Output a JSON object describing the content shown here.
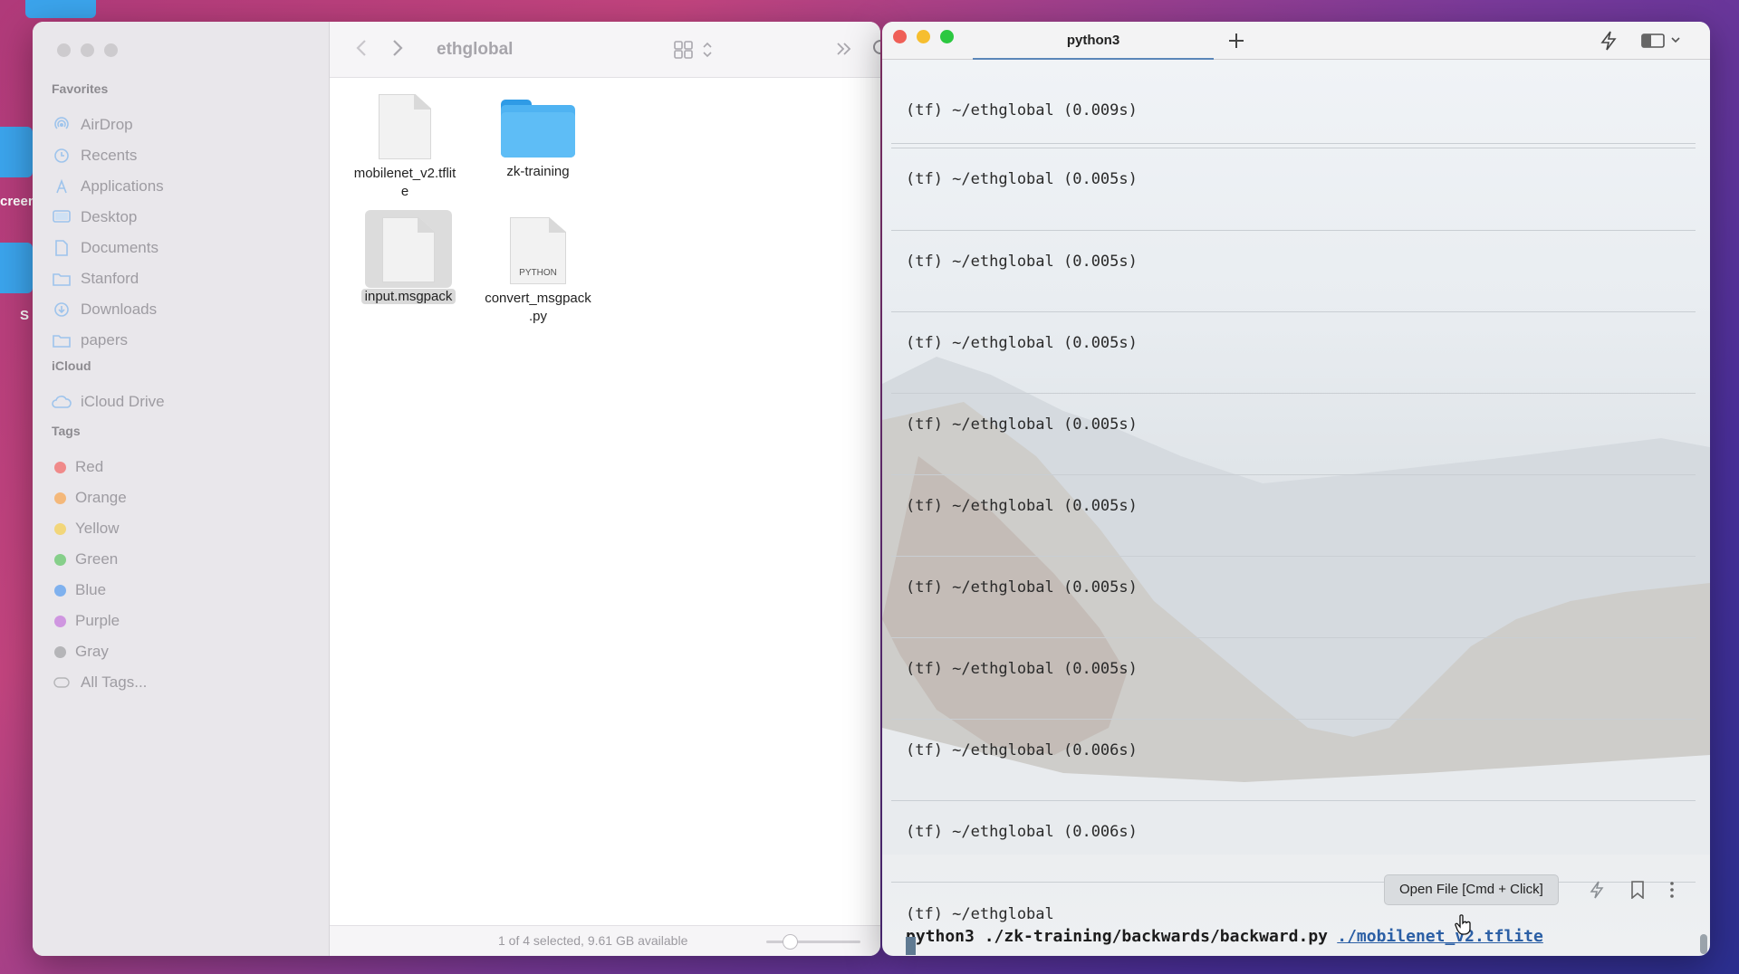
{
  "finder": {
    "title": "ethglobal",
    "sidebar": {
      "favorites_heading": "Favorites",
      "favorites": [
        {
          "label": "AirDrop",
          "icon": "airdrop-icon"
        },
        {
          "label": "Recents",
          "icon": "clock-icon"
        },
        {
          "label": "Applications",
          "icon": "applications-icon"
        },
        {
          "label": "Desktop",
          "icon": "desktop-icon"
        },
        {
          "label": "Documents",
          "icon": "document-icon"
        },
        {
          "label": "Stanford",
          "icon": "folder-icon"
        },
        {
          "label": "Downloads",
          "icon": "download-icon"
        },
        {
          "label": "papers",
          "icon": "folder-icon"
        }
      ],
      "icloud_heading": "iCloud",
      "icloud": [
        {
          "label": "iCloud Drive",
          "icon": "cloud-icon"
        }
      ],
      "tags_heading": "Tags",
      "tags": [
        {
          "label": "Red",
          "color": "#f08a8a"
        },
        {
          "label": "Orange",
          "color": "#f4b87a"
        },
        {
          "label": "Yellow",
          "color": "#f2d67a"
        },
        {
          "label": "Green",
          "color": "#86cf8a"
        },
        {
          "label": "Blue",
          "color": "#7fb1ee"
        },
        {
          "label": "Purple",
          "color": "#cf96e0"
        },
        {
          "label": "Gray",
          "color": "#b5b5b8"
        },
        {
          "label": "All Tags...",
          "color": ""
        }
      ]
    },
    "files": [
      {
        "line1": "mobilenet_v2.tflit",
        "line2": "e",
        "kind": "document",
        "selected": false
      },
      {
        "line1": "zk-training",
        "line2": "",
        "kind": "folder",
        "selected": false
      },
      {
        "line1": "input.msgpack",
        "line2": "",
        "kind": "document",
        "selected": true
      },
      {
        "line1": "convert_msgpack",
        "line2": ".py",
        "kind": "python",
        "badge": "PYTHON",
        "selected": false
      }
    ],
    "status": "1 of 4 selected, 9.61 GB available"
  },
  "desktop": {
    "label1": "creen",
    "label2": "S"
  },
  "terminal": {
    "tab_title": "python3",
    "history": [
      "(tf) ~/ethglobal (0.009s)",
      "(tf) ~/ethglobal (0.005s)",
      "(tf) ~/ethglobal (0.005s)",
      "(tf) ~/ethglobal (0.005s)",
      "(tf) ~/ethglobal (0.005s)",
      "(tf) ~/ethglobal (0.005s)",
      "(tf) ~/ethglobal (0.005s)",
      "(tf) ~/ethglobal (0.005s)",
      "(tf) ~/ethglobal (0.006s)",
      "(tf) ~/ethglobal (0.006s)"
    ],
    "prompt": "(tf) ~/ethglobal",
    "command": "python3 ./zk-training/backwards/backward.py",
    "command_link": "./mobilenet_v2.tflite",
    "tooltip": "Open File [Cmd + Click]"
  }
}
